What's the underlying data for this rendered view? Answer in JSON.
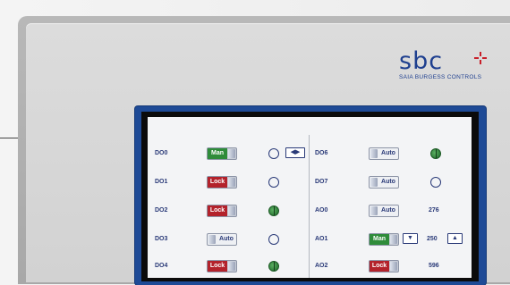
{
  "brand": {
    "logo_text": "sbc",
    "subtitle": "SAIA BURGESS CONTROLS",
    "color": "#1e3f8f",
    "mark_color": "#c8202a"
  },
  "toggle_colors": {
    "man": "#2f8c3a",
    "lock": "#b3222b",
    "auto": "#eef0f4"
  },
  "left_rows": [
    {
      "label": "DO0",
      "state": "Man",
      "indicator": "off",
      "extra": "left-right"
    },
    {
      "label": "DO1",
      "state": "Lock",
      "indicator": "off"
    },
    {
      "label": "DO2",
      "state": "Lock",
      "indicator": "on"
    },
    {
      "label": "DO3",
      "state": "Auto",
      "indicator": "off"
    },
    {
      "label": "DO4",
      "state": "Lock",
      "indicator": "on"
    }
  ],
  "right_rows": [
    {
      "label": "DO6",
      "state": "Auto",
      "indicator": "on"
    },
    {
      "label": "DO7",
      "state": "Auto",
      "indicator": "off"
    },
    {
      "label": "AO0",
      "state": "Auto",
      "value": "276"
    },
    {
      "label": "AO1",
      "state": "Man",
      "value": "250",
      "arrows": true
    },
    {
      "label": "AO2",
      "state": "Lock",
      "value": "596"
    }
  ],
  "icons": {
    "left_right": "◀▶",
    "down": "▼",
    "up": "▲"
  }
}
